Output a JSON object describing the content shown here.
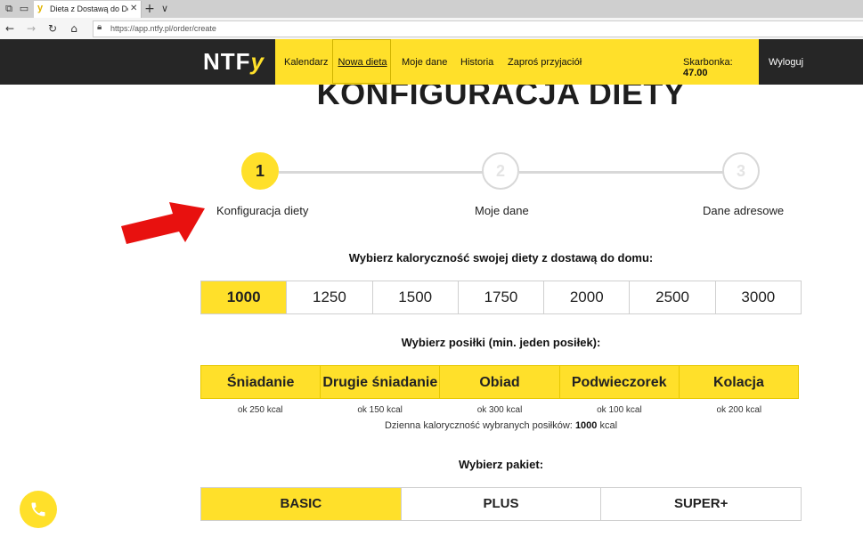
{
  "browser": {
    "tab_title": "Dieta z Dostawą do Dor",
    "tab_favicon": "y",
    "new_tab": "+",
    "tab_menu": "∨",
    "url": "https://app.ntfy.pl/order/create"
  },
  "header": {
    "logo_main": "NTF",
    "logo_accent": "y",
    "nav": {
      "kalendarz": "Kalendarz",
      "nowa_dieta": "Nowa dieta",
      "moje_dane": "Moje dane",
      "historia": "Historia",
      "zapros": "Zaproś przyjaciół"
    },
    "skarbonka_label": "Skarbonka:",
    "skarbonka_value": "47.00",
    "logout": "Wyloguj"
  },
  "page": {
    "title": "KONFIGURACJA DIETY",
    "steps": [
      {
        "number": "1",
        "label": "Konfiguracja diety"
      },
      {
        "number": "2",
        "label": "Moje dane"
      },
      {
        "number": "3",
        "label": "Dane adresowe"
      }
    ],
    "calorie_heading": "Wybierz kaloryczność swojej diety z dostawą do domu:",
    "calories": [
      "1000",
      "1250",
      "1500",
      "1750",
      "2000",
      "2500",
      "3000"
    ],
    "calories_selected": "1000",
    "meals_heading": "Wybierz posiłki (min. jeden posiłek):",
    "meals": [
      {
        "name": "Śniadanie",
        "kcal": "ok 250 kcal"
      },
      {
        "name": "Drugie śniadanie",
        "kcal": "ok 150 kcal"
      },
      {
        "name": "Obiad",
        "kcal": "ok 300 kcal"
      },
      {
        "name": "Podwieczorek",
        "kcal": "ok 100 kcal"
      },
      {
        "name": "Kolacja",
        "kcal": "ok 200 kcal"
      }
    ],
    "daily_label": "Dzienna kaloryczność wybranych posiłków:",
    "daily_value": "1000",
    "daily_unit": "kcal",
    "package_heading": "Wybierz pakiet:",
    "packages": [
      "BASIC",
      "PLUS",
      "SUPER+"
    ],
    "package_selected": "BASIC"
  },
  "colors": {
    "accent": "#ffe02a",
    "header_bg": "#262626",
    "arrow": "#e8110f"
  }
}
